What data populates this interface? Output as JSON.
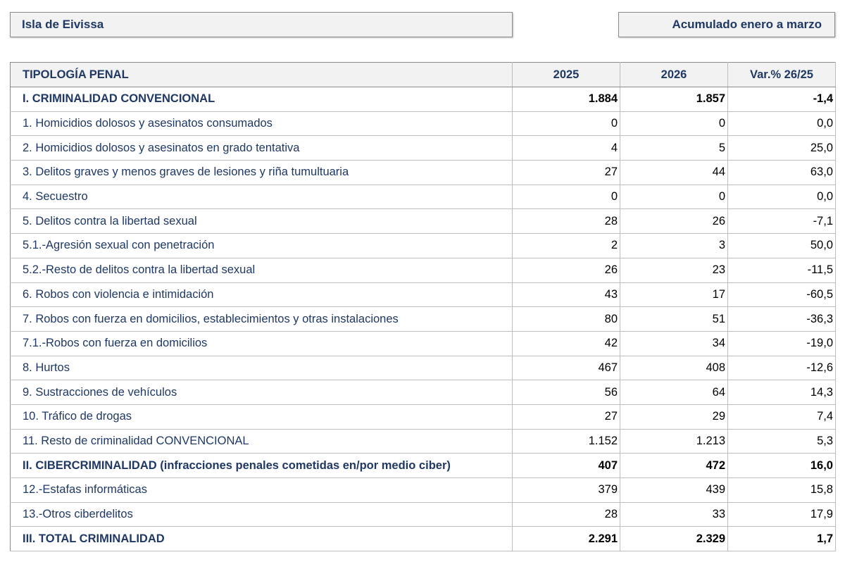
{
  "header": {
    "region": "Isla  de Eivissa",
    "period": "Acumulado enero a marzo"
  },
  "table": {
    "columns": [
      "TIPOLOGÍA PENAL",
      "2025",
      "2026",
      "Var.% 26/25"
    ],
    "rows": [
      {
        "label": "I. CRIMINALIDAD CONVENCIONAL",
        "y2025": "1.884",
        "y2026": "1.857",
        "var": "-1,4",
        "section": true
      },
      {
        "label": "1. Homicidios dolosos y asesinatos consumados",
        "y2025": "0",
        "y2026": "0",
        "var": "0,0",
        "section": false
      },
      {
        "label": "2. Homicidios dolosos y asesinatos en grado tentativa",
        "y2025": "4",
        "y2026": "5",
        "var": "25,0",
        "section": false
      },
      {
        "label": "3. Delitos graves y menos graves de lesiones y riña tumultuaria",
        "y2025": "27",
        "y2026": "44",
        "var": "63,0",
        "section": false
      },
      {
        "label": "4. Secuestro",
        "y2025": "0",
        "y2026": "0",
        "var": "0,0",
        "section": false
      },
      {
        "label": "5. Delitos contra la libertad sexual",
        "y2025": "28",
        "y2026": "26",
        "var": "-7,1",
        "section": false
      },
      {
        "label": "5.1.-Agresión sexual con penetración",
        "y2025": "2",
        "y2026": "3",
        "var": "50,0",
        "section": false
      },
      {
        "label": "5.2.-Resto de delitos contra la libertad sexual",
        "y2025": "26",
        "y2026": "23",
        "var": "-11,5",
        "section": false
      },
      {
        "label": "6. Robos con violencia e intimidación",
        "y2025": "43",
        "y2026": "17",
        "var": "-60,5",
        "section": false
      },
      {
        "label": "7. Robos con fuerza en domicilios, establecimientos y otras instalaciones",
        "y2025": "80",
        "y2026": "51",
        "var": "-36,3",
        "section": false
      },
      {
        "label": "7.1.-Robos con fuerza en domicilios",
        "y2025": "42",
        "y2026": "34",
        "var": "-19,0",
        "section": false
      },
      {
        "label": "8. Hurtos",
        "y2025": "467",
        "y2026": "408",
        "var": "-12,6",
        "section": false
      },
      {
        "label": "9. Sustracciones de vehículos",
        "y2025": "56",
        "y2026": "64",
        "var": "14,3",
        "section": false
      },
      {
        "label": "10. Tráfico de drogas",
        "y2025": "27",
        "y2026": "29",
        "var": "7,4",
        "section": false
      },
      {
        "label": "11. Resto de criminalidad CONVENCIONAL",
        "y2025": "1.152",
        "y2026": "1.213",
        "var": "5,3",
        "section": false
      },
      {
        "label": "II. CIBERCRIMINALIDAD (infracciones penales cometidas en/por medio ciber)",
        "y2025": "407",
        "y2026": "472",
        "var": "16,0",
        "section": true
      },
      {
        "label": "12.-Estafas informáticas",
        "y2025": "379",
        "y2026": "439",
        "var": "15,8",
        "section": false
      },
      {
        "label": "13.-Otros ciberdelitos",
        "y2025": "28",
        "y2026": "33",
        "var": "17,9",
        "section": false
      },
      {
        "label": "III. TOTAL CRIMINALIDAD",
        "y2025": "2.291",
        "y2026": "2.329",
        "var": "1,7",
        "section": true
      }
    ]
  }
}
